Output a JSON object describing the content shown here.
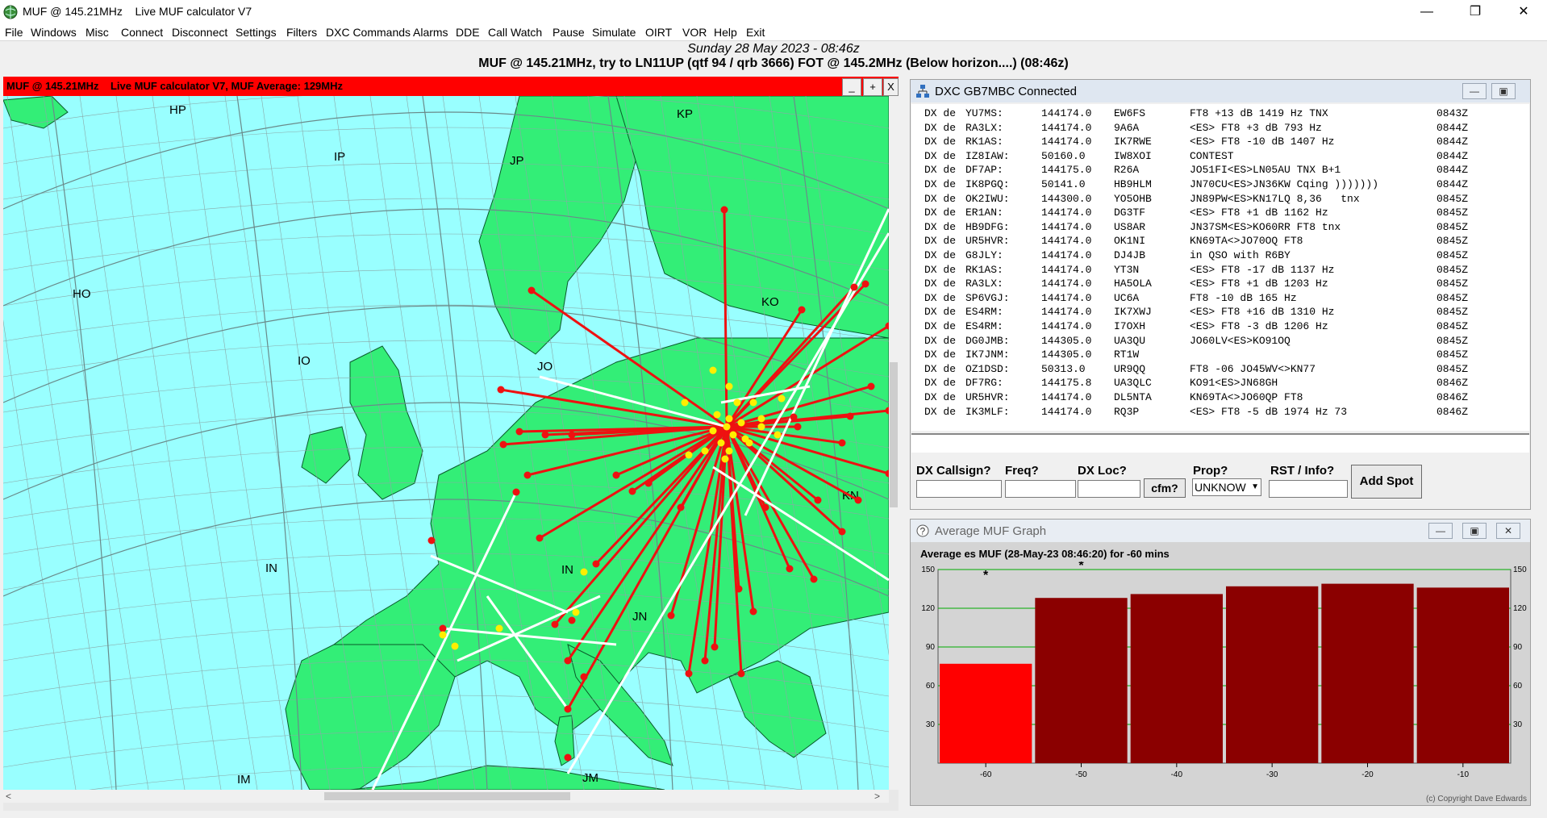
{
  "window": {
    "title": "MUF @ 145.21MHz    Live MUF calculator V7",
    "minimize": "—",
    "maximize": "❐",
    "close": "✕"
  },
  "menu": [
    "File",
    "Windows",
    "Misc",
    "Connect",
    "Disconnect",
    "Settings",
    "Filters",
    "DXC Commands",
    "Alarms",
    "DDE",
    "Call Watch",
    "Pause",
    "Simulate",
    "OIRT",
    "VOR",
    "Help",
    "Exit"
  ],
  "header": {
    "date": "Sunday 28 May 2023 - 08:46z",
    "info": "MUF @ 145.21MHz, try to LN11UP (qtf 94 / qrb 3666)     FOT @ 145.2MHz (Below horizon....) (08:46z)"
  },
  "map_window": {
    "title": "MUF @ 145.21MHz    Live MUF calculator V7, MUF Average: 129MHz",
    "buttons": [
      "_",
      "+",
      "X"
    ],
    "grid_labels": [
      "HP",
      "IP",
      "JP",
      "KP",
      "HO",
      "IO",
      "KO",
      "IN",
      "IN",
      "IM",
      "JM",
      "JN",
      "KN",
      "JO"
    ],
    "colors": {
      "sea": "#99ffff",
      "land": "#33ee77",
      "path": "#ee1111",
      "path_white": "#ffffff",
      "spot_red": "#ee1111",
      "spot_yellow": "#ffee00"
    }
  },
  "dxc": {
    "title": "DXC GB7MBC Connected",
    "spots": [
      {
        "prefix": "DX de",
        "spotter": "YU7MS:",
        "freq": "144174.0",
        "call": "EW6FS",
        "comment": "FT8 +13 dB 1419 Hz TNX",
        "time": "0843Z"
      },
      {
        "prefix": "DX de",
        "spotter": "RA3LX:",
        "freq": "144174.0",
        "call": "9A6A",
        "comment": "<ES> FT8 +3 dB 793 Hz",
        "time": "0844Z"
      },
      {
        "prefix": "DX de",
        "spotter": "RK1AS:",
        "freq": "144174.0",
        "call": "IK7RWE",
        "comment": "<ES> FT8 -10 dB 1407 Hz",
        "time": "0844Z"
      },
      {
        "prefix": "DX de",
        "spotter": "IZ8IAW:",
        "freq": "50160.0",
        "call": "IW8XOI",
        "comment": "CONTEST",
        "time": "0844Z"
      },
      {
        "prefix": "DX de",
        "spotter": "DF7AP:",
        "freq": "144175.0",
        "call": "R26A",
        "comment": "JO51FI<ES>LN05AU TNX B+1",
        "time": "0844Z"
      },
      {
        "prefix": "DX de",
        "spotter": "IK8PGQ:",
        "freq": "50141.0",
        "call": "HB9HLM",
        "comment": "JN70CU<ES>JN36KW Cqing )))))))",
        "time": "0844Z"
      },
      {
        "prefix": "DX de",
        "spotter": "OK2IWU:",
        "freq": "144300.0",
        "call": "YO5OHB",
        "comment": "JN89PW<ES>KN17LQ 8,36   tnx",
        "time": "0845Z"
      },
      {
        "prefix": "DX de",
        "spotter": "ER1AN:",
        "freq": "144174.0",
        "call": "DG3TF",
        "comment": "<ES> FT8 +1 dB 1162 Hz",
        "time": "0845Z"
      },
      {
        "prefix": "DX de",
        "spotter": "HB9DFG:",
        "freq": "144174.0",
        "call": "US8AR",
        "comment": "JN37SM<ES>KO60RR FT8 tnx",
        "time": "0845Z"
      },
      {
        "prefix": "DX de",
        "spotter": "UR5HVR:",
        "freq": "144174.0",
        "call": "OK1NI",
        "comment": "KN69TA<>JO70OQ FT8",
        "time": "0845Z"
      },
      {
        "prefix": "DX de",
        "spotter": "G8JLY:",
        "freq": "144174.0",
        "call": "DJ4JB",
        "comment": "in QSO with R6BY",
        "time": "0845Z"
      },
      {
        "prefix": "DX de",
        "spotter": "RK1AS:",
        "freq": "144174.0",
        "call": "YT3N",
        "comment": "<ES> FT8 -17 dB 1137 Hz",
        "time": "0845Z"
      },
      {
        "prefix": "DX de",
        "spotter": "RA3LX:",
        "freq": "144174.0",
        "call": "HA5OLA",
        "comment": "<ES> FT8 +1 dB 1203 Hz",
        "time": "0845Z"
      },
      {
        "prefix": "DX de",
        "spotter": "SP6VGJ:",
        "freq": "144174.0",
        "call": "UC6A",
        "comment": "FT8 -10 dB 165 Hz",
        "time": "0845Z"
      },
      {
        "prefix": "DX de",
        "spotter": "ES4RM:",
        "freq": "144174.0",
        "call": "IK7XWJ",
        "comment": "<ES> FT8 +16 dB 1310 Hz",
        "time": "0845Z"
      },
      {
        "prefix": "DX de",
        "spotter": "ES4RM:",
        "freq": "144174.0",
        "call": "I7OXH",
        "comment": "<ES> FT8 -3 dB 1206 Hz",
        "time": "0845Z"
      },
      {
        "prefix": "DX de",
        "spotter": "DG0JMB:",
        "freq": "144305.0",
        "call": "UA3QU",
        "comment": "JO60LV<ES>KO91OQ",
        "time": "0845Z"
      },
      {
        "prefix": "DX de",
        "spotter": "IK7JNM:",
        "freq": "144305.0",
        "call": "RT1W",
        "comment": "",
        "time": "0845Z"
      },
      {
        "prefix": "DX de",
        "spotter": "OZ1DSD:",
        "freq": "50313.0",
        "call": "UR9QQ",
        "comment": "FT8 -06 JO45WV<>KN77",
        "time": "0845Z"
      },
      {
        "prefix": "DX de",
        "spotter": "DF7RG:",
        "freq": "144175.8",
        "call": "UA3QLC",
        "comment": "KO91<ES>JN68GH",
        "time": "0846Z"
      },
      {
        "prefix": "DX de",
        "spotter": "UR5HVR:",
        "freq": "144174.0",
        "call": "DL5NTA",
        "comment": "KN69TA<>JO60QP FT8",
        "time": "0846Z"
      },
      {
        "prefix": "DX de",
        "spotter": "IK3MLF:",
        "freq": "144174.0",
        "call": "RQ3P",
        "comment": "<ES> FT8 -5 dB 1974 Hz 73",
        "time": "0846Z"
      }
    ],
    "form": {
      "callsign_label": "DX Callsign?",
      "freq_label": "Freq?",
      "loc_label": "DX Loc?",
      "cfm_button": "cfm?",
      "prop_label": "Prop?",
      "prop_value": "UNKNOW",
      "rst_label": "RST / Info?",
      "add_button": "Add Spot"
    }
  },
  "graph": {
    "title": "Average MUF Graph",
    "subtitle": "Average es MUF (28-May-23 08:46:20) for -60 mins",
    "copyright": "(c) Copyright Dave Edwards",
    "colors": {
      "current": "#ff0000",
      "past": "#8b0000",
      "grid": "#00aa00",
      "bg": "#d4d4d4"
    }
  },
  "chart_data": {
    "type": "bar",
    "categories": [
      "-60",
      "-50",
      "-40",
      "-30",
      "-20",
      "-10"
    ],
    "values": [
      77,
      128,
      131,
      137,
      139,
      136
    ],
    "ylim": [
      0,
      150
    ],
    "yticks": [
      "30",
      "60",
      "90",
      "120",
      "150"
    ],
    "grid": true,
    "markers": [
      {
        "x": "-60",
        "label": "*"
      },
      {
        "x": "-50",
        "label": "*"
      }
    ]
  }
}
